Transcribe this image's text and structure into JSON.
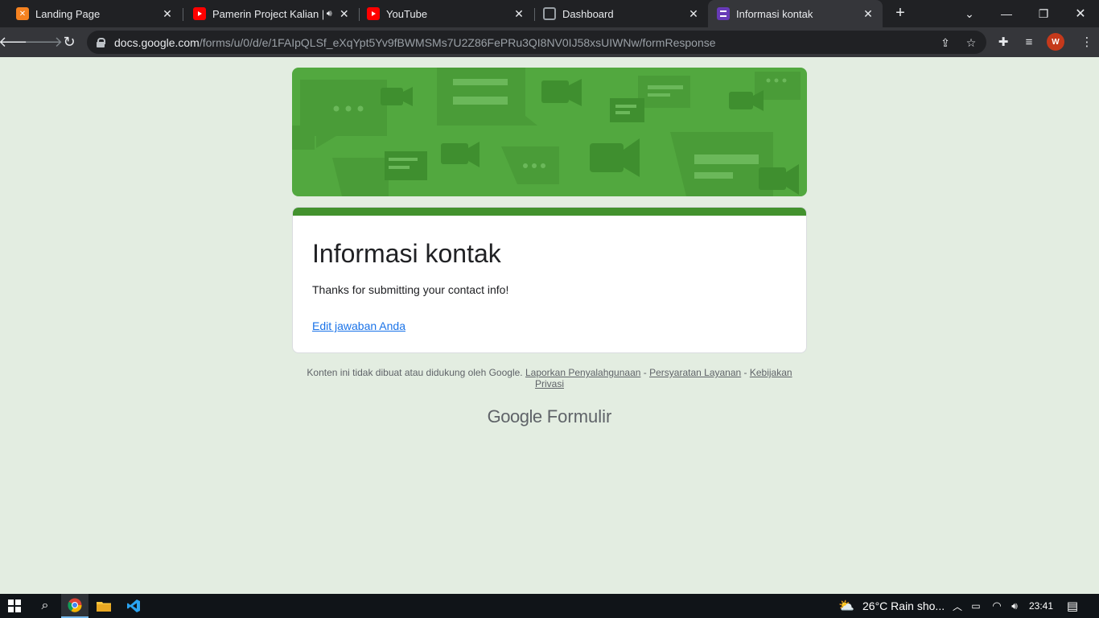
{
  "tabs": [
    {
      "title": "Landing Page",
      "icon": "xampp-icon"
    },
    {
      "title": "Pamerin Project Kalian | D",
      "icon": "youtube-icon",
      "audio": true
    },
    {
      "title": "YouTube",
      "icon": "youtube-icon"
    },
    {
      "title": "Dashboard",
      "icon": "globe-icon"
    },
    {
      "title": "Informasi kontak",
      "icon": "google-forms-icon",
      "active": true
    }
  ],
  "omnibox": {
    "host": "docs.google.com",
    "path": "/forms/u/0/d/e/1FAIpQLSf_eXqYpt5Yv9fBWMSMs7U2Z86FePRu3QI8NV0IJ58xsUIWNw/formResponse"
  },
  "profile": {
    "initial": "W",
    "color": "#c5391b"
  },
  "form": {
    "title": "Informasi kontak",
    "confirmation": "Thanks for submitting your contact info!",
    "edit_link": "Edit jawaban Anda",
    "theme_color": "#43922e",
    "background_color": "#e3ede1"
  },
  "footer": {
    "note": "Konten ini tidak dibuat atau didukung oleh Google.",
    "sep": " - ",
    "report": "Laporkan Penyalahgunaan",
    "terms": "Persyaratan Layanan",
    "privacy": "Kebijakan Privasi",
    "brand_google": "Google",
    "brand_product": "Formulir"
  },
  "taskbar": {
    "weather": "26°C  Rain sho...",
    "time": "23:41"
  }
}
